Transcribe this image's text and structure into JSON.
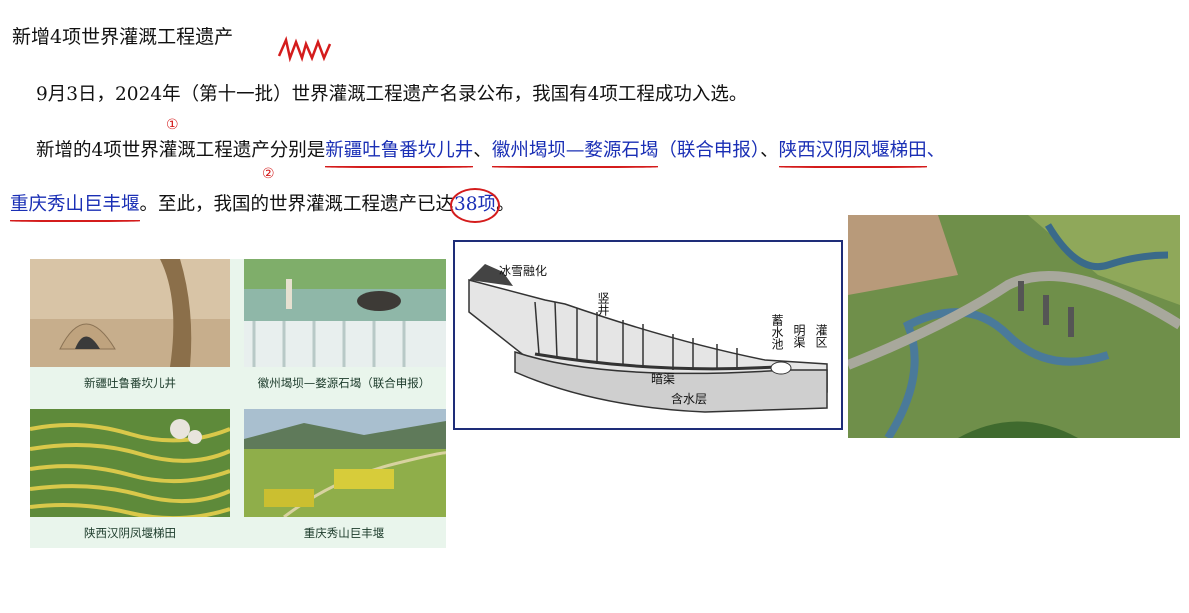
{
  "heading": "新增4项世界灌溉工程遗产",
  "paragraph1": "9月3日，2024年（第十一批）世界灌溉工程遗产名录公布，我国有4项工程成功入选。",
  "paragraph2": {
    "intro": "新增的4项世界灌溉工程遗产分别是",
    "item1": "新疆吐鲁番坎儿井",
    "sep1": "、",
    "item2": "徽州堨坝—婺源石堨",
    "joint": "（联合申报）",
    "sep2": "、",
    "item3": "陕西汉阴凤堰梯田",
    "sep3": "、"
  },
  "paragraph3": {
    "item4": "重庆秀山巨丰堰",
    "text1": "。至此，我国的世界灌溉工程遗产已达",
    "count": "38项",
    "end": "。"
  },
  "annotations": {
    "mark1": "①",
    "mark2": "②"
  },
  "photo_captions": [
    "新疆吐鲁番坎儿井",
    "徽州堨坝—婺源石堨（联合申报）",
    "陕西汉阴凤堰梯田",
    "重庆秀山巨丰堰"
  ],
  "diagram_labels": {
    "snow": "冰雪融化",
    "shaft": "竖井",
    "reservoir": "蓄水池",
    "open_channel": "明渠",
    "irrigation": "灌区",
    "dark_channel": "暗渠",
    "aquifer": "含水层"
  },
  "colors": {
    "link_blue": "#1a2fb5",
    "ink_red": "#d41c1c",
    "frame_navy": "#1e2d78"
  }
}
